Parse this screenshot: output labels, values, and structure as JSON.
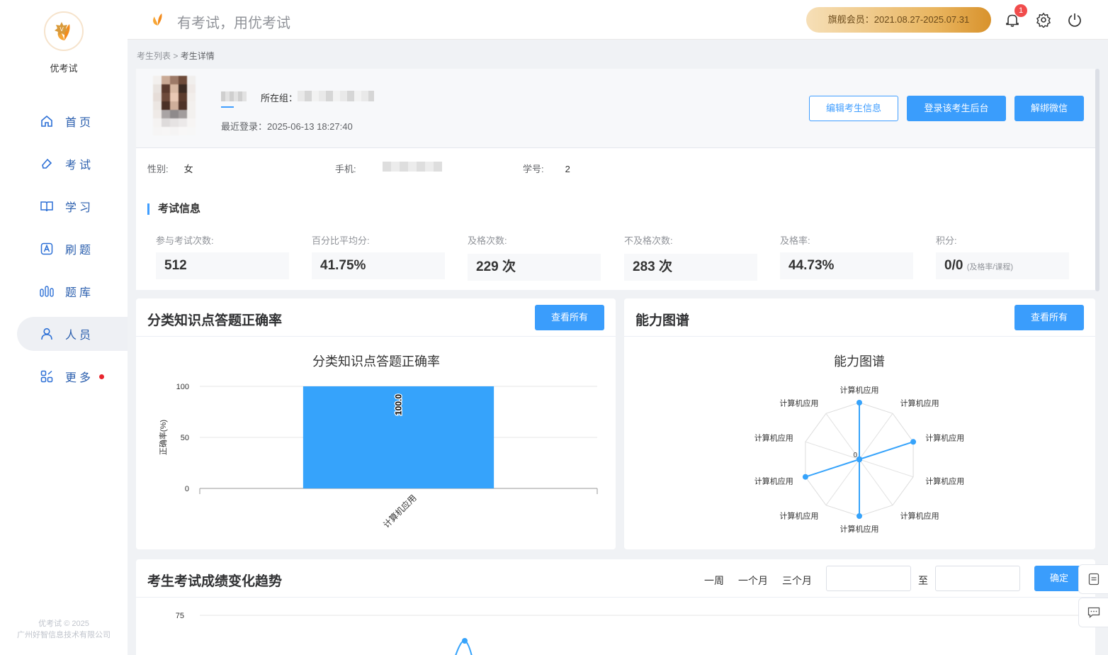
{
  "app": {
    "name": "优考试",
    "slogan": "有考试，用优考试",
    "copyright": "优考试 © 2025",
    "company": "广州好智信息技术有限公司"
  },
  "nav": [
    {
      "label": "首页",
      "icon": "home-icon"
    },
    {
      "label": "考试",
      "icon": "eraser-icon"
    },
    {
      "label": "学习",
      "icon": "book-icon"
    },
    {
      "label": "刷题",
      "icon": "letter-a-icon"
    },
    {
      "label": "题库",
      "icon": "bars-icon"
    },
    {
      "label": "人员",
      "icon": "user-icon",
      "active": true
    },
    {
      "label": "更多",
      "icon": "grid-icon",
      "dot": true
    }
  ],
  "header": {
    "member": "旗舰会员：2021.08.27-2025.07.31",
    "notifications": "1"
  },
  "breadcrumb": {
    "parent": "考生列表",
    "sep": ">",
    "current": "考生详情"
  },
  "profile": {
    "group_label": "所在组：",
    "last_login": "最近登录：2025-06-13 18:27:40",
    "buttons": {
      "edit": "编辑考生信息",
      "login": "登录该考生后台",
      "unbind": "解绑微信"
    }
  },
  "info": {
    "gender_label": "性别:",
    "gender": "女",
    "phone_label": "手机:",
    "sid_label": "学号:",
    "sid": "2"
  },
  "exam_info": {
    "title": "考试信息",
    "stats": [
      {
        "label": "参与考试次数:",
        "value": "512"
      },
      {
        "label": "百分比平均分:",
        "value": "41.75%"
      },
      {
        "label": "及格次数:",
        "value": "229 次"
      },
      {
        "label": "不及格次数:",
        "value": "283 次"
      },
      {
        "label": "及格率:",
        "value": "44.73%"
      },
      {
        "label": "积分:",
        "value": "0/0",
        "note": "(及格率/课程)"
      }
    ]
  },
  "accuracy_panel": {
    "title": "分类知识点答题正确率",
    "button": "查看所有"
  },
  "ability_panel": {
    "title": "能力图谱",
    "button": "查看所有"
  },
  "trend_panel": {
    "title": "考生考试成绩变化趋势",
    "ranges": [
      "一周",
      "一个月",
      "三个月"
    ],
    "to": "至",
    "confirm": "确定"
  },
  "chart_data": [
    {
      "type": "bar",
      "title": "分类知识点答题正确率",
      "ylabel": "正确率(%)",
      "ylim": [
        0,
        100
      ],
      "yticks": [
        0,
        50,
        100
      ],
      "categories": [
        "计算机应用"
      ],
      "values": [
        100.0
      ],
      "value_labels": [
        "100.0"
      ],
      "color": "#36a3fb"
    },
    {
      "type": "radar",
      "title": "能力图谱",
      "axes": [
        "计算机应用",
        "计算机应用",
        "计算机应用",
        "计算机应用",
        "计算机应用",
        "计算机应用",
        "计算机应用",
        "计算机应用",
        "计算机应用",
        "计算机应用"
      ],
      "values": [
        100,
        0,
        100,
        0,
        0,
        100,
        0,
        100,
        0,
        0
      ],
      "center_label": "0",
      "color": "#36a3fb"
    },
    {
      "type": "line",
      "title": "考生考试成绩变化趋势",
      "yticks": [
        75
      ],
      "color": "#36a3fb"
    }
  ]
}
